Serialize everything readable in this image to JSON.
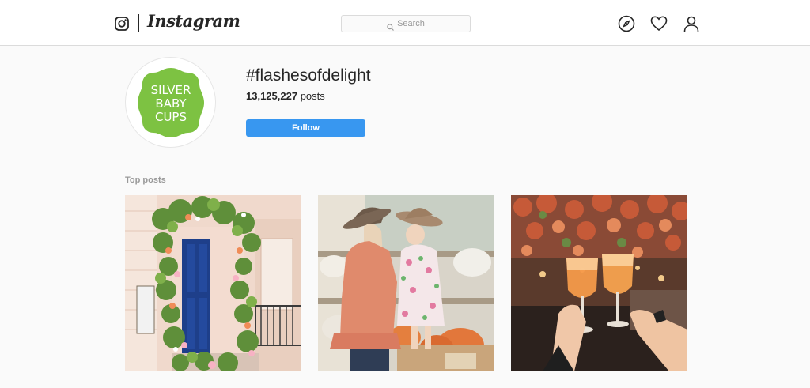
{
  "app": {
    "logo_text": "Instagram",
    "logo_icon": "instagram-camera-icon"
  },
  "search": {
    "placeholder": "Search",
    "icon": "search-icon"
  },
  "nav": {
    "icons": [
      "compass-icon",
      "heart-icon",
      "profile-icon"
    ]
  },
  "hashtag_page": {
    "avatar_brand_text": [
      "SILVER",
      "BABY",
      "CUPS"
    ],
    "title": "#flashesofdelight",
    "post_count": "13,125,227",
    "post_count_unit": "posts",
    "follow_label": "Follow"
  },
  "top_posts": {
    "label": "Top posts",
    "posts": [
      {
        "subject": "flower-covered-doorway"
      },
      {
        "subject": "mother-and-daughter-with-pumpkins"
      },
      {
        "subject": "cocktail-toast-under-floral-ceiling"
      }
    ]
  },
  "colors": {
    "accent": "#3897f0",
    "background": "#fafafa",
    "brand_green": "#7dc242"
  }
}
